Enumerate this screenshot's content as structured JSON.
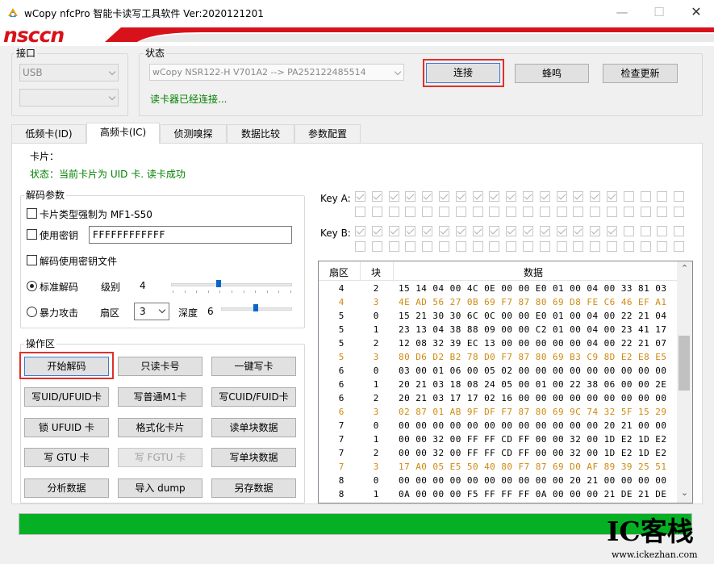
{
  "window": {
    "title": "wCopy nfcPro 智能卡读写工具软件  Ver:2020121201",
    "minimize_glyph": "—",
    "maximize_glyph": "☐",
    "close_glyph": "✕"
  },
  "banner": {
    "logo_text": "nsccn",
    "brand_color": "#d8121a"
  },
  "interface_group": {
    "label": "接口",
    "port_value": "USB",
    "second_value": ""
  },
  "status_group": {
    "label": "状态",
    "device_value": "wCopy NSR122-H V701A2 --> PA252122485514",
    "status_text": "读卡器已经连接...",
    "status_color": "#008000"
  },
  "top_buttons": {
    "connect": "连接",
    "beep": "蜂鸣",
    "update": "检查更新"
  },
  "tabs": [
    {
      "label": "低频卡(ID)",
      "active": false
    },
    {
      "label": "高频卡(IC)",
      "active": true
    },
    {
      "label": "侦测嗅探",
      "active": false
    },
    {
      "label": "数据比较",
      "active": false
    },
    {
      "label": "参数配置",
      "active": false
    }
  ],
  "card": {
    "label": "卡片：",
    "status": "状态：当前卡片为 UID 卡. 读卡成功"
  },
  "decode_params": {
    "label": "解码参数",
    "force_mf1": {
      "label": "卡片类型强制为 MF1-S50",
      "checked": false
    },
    "use_key": {
      "label": "使用密钥",
      "checked": false,
      "key_value": "FFFFFFFFFFFF"
    },
    "use_key_file": {
      "label": "解码使用密钥文件",
      "checked": false
    },
    "standard": {
      "label": "标准解码",
      "selected": true,
      "level_label": "级别",
      "level_value": "4",
      "level_fraction": 0.4
    },
    "brute": {
      "label": "暴力攻击",
      "selected": false,
      "sector_label": "扇区",
      "sector_value": "3",
      "depth_label": "深度",
      "depth_value": "6",
      "depth_fraction": 0.5
    }
  },
  "keys": {
    "key_a_label": "Key A:",
    "key_b_label": "Key B:",
    "key_a_row1": [
      true,
      true,
      true,
      true,
      true,
      true,
      true,
      true,
      true,
      true,
      true,
      true,
      true,
      true,
      true,
      true,
      false,
      false,
      false,
      false
    ],
    "key_a_row2": [
      false,
      false,
      false,
      false,
      false,
      false,
      false,
      false,
      false,
      false,
      false,
      false,
      false,
      false,
      false,
      false,
      false,
      false,
      false,
      false
    ],
    "key_b_row1": [
      true,
      true,
      true,
      true,
      true,
      true,
      true,
      true,
      true,
      true,
      true,
      true,
      true,
      true,
      true,
      true,
      false,
      false,
      false,
      false
    ],
    "key_b_row2": [
      false,
      false,
      false,
      false,
      false,
      false,
      false,
      false,
      false,
      false,
      false,
      false,
      false,
      false,
      false,
      false,
      false,
      false,
      false,
      false
    ]
  },
  "ops": {
    "label": "操作区",
    "buttons": [
      {
        "label": "开始解码",
        "enabled": true,
        "highlight": true
      },
      {
        "label": "只读卡号",
        "enabled": true,
        "highlight": false
      },
      {
        "label": "一键写卡",
        "enabled": true,
        "highlight": false
      },
      {
        "label": "写UID/UFUID卡",
        "enabled": true,
        "highlight": false
      },
      {
        "label": "写普通M1卡",
        "enabled": true,
        "highlight": false
      },
      {
        "label": "写CUID/FUID卡",
        "enabled": true,
        "highlight": false
      },
      {
        "label": "锁 UFUID 卡",
        "enabled": true,
        "highlight": false
      },
      {
        "label": "格式化卡片",
        "enabled": true,
        "highlight": false
      },
      {
        "label": "读单块数据",
        "enabled": true,
        "highlight": false
      },
      {
        "label": "写 GTU 卡",
        "enabled": true,
        "highlight": false
      },
      {
        "label": "写 FGTU 卡",
        "enabled": false,
        "highlight": false
      },
      {
        "label": "写单块数据",
        "enabled": true,
        "highlight": false
      },
      {
        "label": "分析数据",
        "enabled": true,
        "highlight": false
      },
      {
        "label": "导入 dump",
        "enabled": true,
        "highlight": false
      },
      {
        "label": "另存数据",
        "enabled": true,
        "highlight": false
      }
    ]
  },
  "table": {
    "headers": {
      "sector": "扇区",
      "block": "块",
      "data": "数据"
    },
    "highlight_color": "#d08a10",
    "rows": [
      {
        "sector": "4",
        "block": "2",
        "data": "15 14 04 00 4C 0E 00 00 E0 01 00 04 00 33 81 03",
        "hl": false
      },
      {
        "sector": "4",
        "block": "3",
        "data": "4E AD 56 27 0B 69 F7 87 80 69 D8 FE C6 46 EF A1",
        "hl": true
      },
      {
        "sector": "5",
        "block": "0",
        "data": "15 21 30 30 6C 0C 00 00 E0 01 00 04 00 22 21 04",
        "hl": false
      },
      {
        "sector": "5",
        "block": "1",
        "data": "23 13 04 38 88 09 00 00 C2 01 00 04 00 23 41 17",
        "hl": false
      },
      {
        "sector": "5",
        "block": "2",
        "data": "12 08 32 39 EC 13 00 00 00 00 00 04 00 22 21 07",
        "hl": false
      },
      {
        "sector": "5",
        "block": "3",
        "data": "80 D6 D2 B2 78 D0 F7 87 80 69 B3 C9 8D E2 E8 E5",
        "hl": true
      },
      {
        "sector": "6",
        "block": "0",
        "data": "03 00 01 06 00 05 02 00 00 00 00 00 00 00 00 00",
        "hl": false
      },
      {
        "sector": "6",
        "block": "1",
        "data": "20 21 03 18 08 24 05 00 01 00 22 38 06 00 00 2E",
        "hl": false
      },
      {
        "sector": "6",
        "block": "2",
        "data": "20 21 03 17 17 02 16 00 00 00 00 00 00 00 00 00",
        "hl": false
      },
      {
        "sector": "6",
        "block": "3",
        "data": "02 87 01 AB 9F DF F7 87 80 69 9C 74 32 5F 15 29",
        "hl": true
      },
      {
        "sector": "7",
        "block": "0",
        "data": "00 00 00 00 00 00 00 00 00 00 00 00 20 21 00 00",
        "hl": false
      },
      {
        "sector": "7",
        "block": "1",
        "data": "00 00 32 00 FF FF CD FF 00 00 32 00 1D E2 1D E2",
        "hl": false
      },
      {
        "sector": "7",
        "block": "2",
        "data": "00 00 32 00 FF FF CD FF 00 00 32 00 1D E2 1D E2",
        "hl": false
      },
      {
        "sector": "7",
        "block": "3",
        "data": "17 A0 05 E5 50 40 80 F7 87 69 D0 AF 89 39 25 51",
        "hl": true
      },
      {
        "sector": "8",
        "block": "0",
        "data": "00 00 00 00 00 00 00 00 00 00 20 21 00 00 00 00",
        "hl": false
      },
      {
        "sector": "8",
        "block": "1",
        "data": "0A 00 00 00 F5 FF FF FF 0A 00 00 00 21 DE 21 DE",
        "hl": false
      }
    ],
    "scroll_up_glyph": "⌃",
    "scroll_down_glyph": "⌄"
  },
  "progress": {
    "percent": 100,
    "color": "#06b025"
  },
  "watermark": {
    "logo": "IC客栈",
    "url": "www.ickezhan.com"
  }
}
